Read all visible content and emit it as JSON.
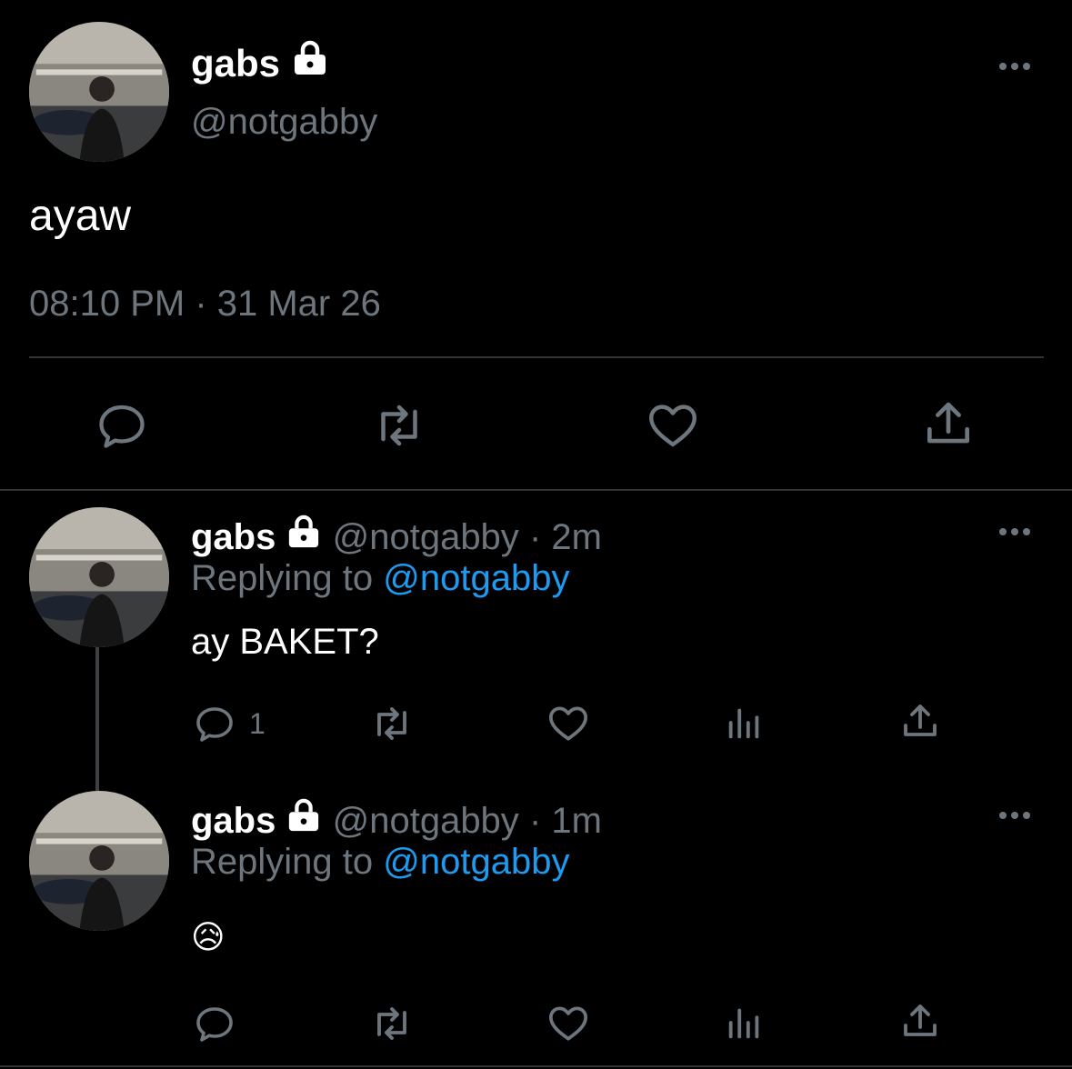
{
  "main_tweet": {
    "display_name": "gabs",
    "handle": "@notgabby",
    "text": "ayaw",
    "timestamp": "08:10 PM · 31 Mar 26",
    "more_icon": "more-horizontal-icon",
    "actions": [
      "reply-icon",
      "retweet-icon",
      "like-icon",
      "share-icon"
    ]
  },
  "replies": [
    {
      "display_name": "gabs",
      "handle": "@notgabby",
      "time": "· 2m",
      "replying_prefix": "Replying to",
      "replying_to": "@notgabby",
      "text": "ay BAKET?",
      "reply_count": "1"
    },
    {
      "display_name": "gabs",
      "handle": "@notgabby",
      "time": "· 1m",
      "replying_prefix": "Replying to",
      "replying_to": "@notgabby",
      "text": "😥",
      "reply_count": ""
    }
  ],
  "colors": {
    "background": "#000000",
    "muted": "#6e767d",
    "link": "#1d9bf0",
    "divider": "#2f3336"
  }
}
